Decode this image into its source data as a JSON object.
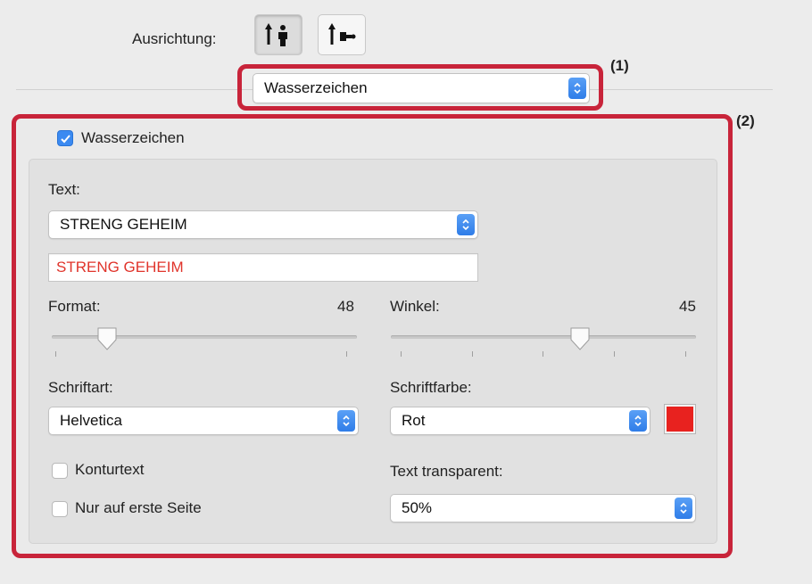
{
  "orientation": {
    "label": "Ausrichtung:",
    "options": [
      {
        "icon": "portrait-orientation-icon",
        "selected": true
      },
      {
        "icon": "landscape-orientation-icon",
        "selected": false
      }
    ]
  },
  "callouts": {
    "one": "(1)",
    "two": "(2)"
  },
  "section_menu": {
    "value": "Wasserzeichen"
  },
  "watermark": {
    "enabled_label": "Wasserzeichen",
    "enabled": true,
    "text_label": "Text:",
    "text_select_value": "STRENG GEHEIM",
    "text_field_value": "STRENG GEHEIM",
    "text_color": "#e0342b",
    "size_label": "Format:",
    "size_value": "48",
    "size_level": 0.18,
    "angle_label": "Winkel:",
    "angle_value": "45",
    "angle_level": 0.62,
    "font_label": "Schriftart:",
    "font_value": "Helvetica",
    "color_label": "Schriftfarbe:",
    "color_value": "Rot",
    "color_swatch": "#e8221f",
    "outline_label": "Konturtext",
    "outline_checked": false,
    "first_page_label": "Nur auf erste Seite",
    "first_page_checked": false,
    "transparency_label": "Text transparent:",
    "transparency_value": "50%"
  },
  "colors": {
    "highlight": "#c8243a",
    "accent": "#3b8af1"
  }
}
